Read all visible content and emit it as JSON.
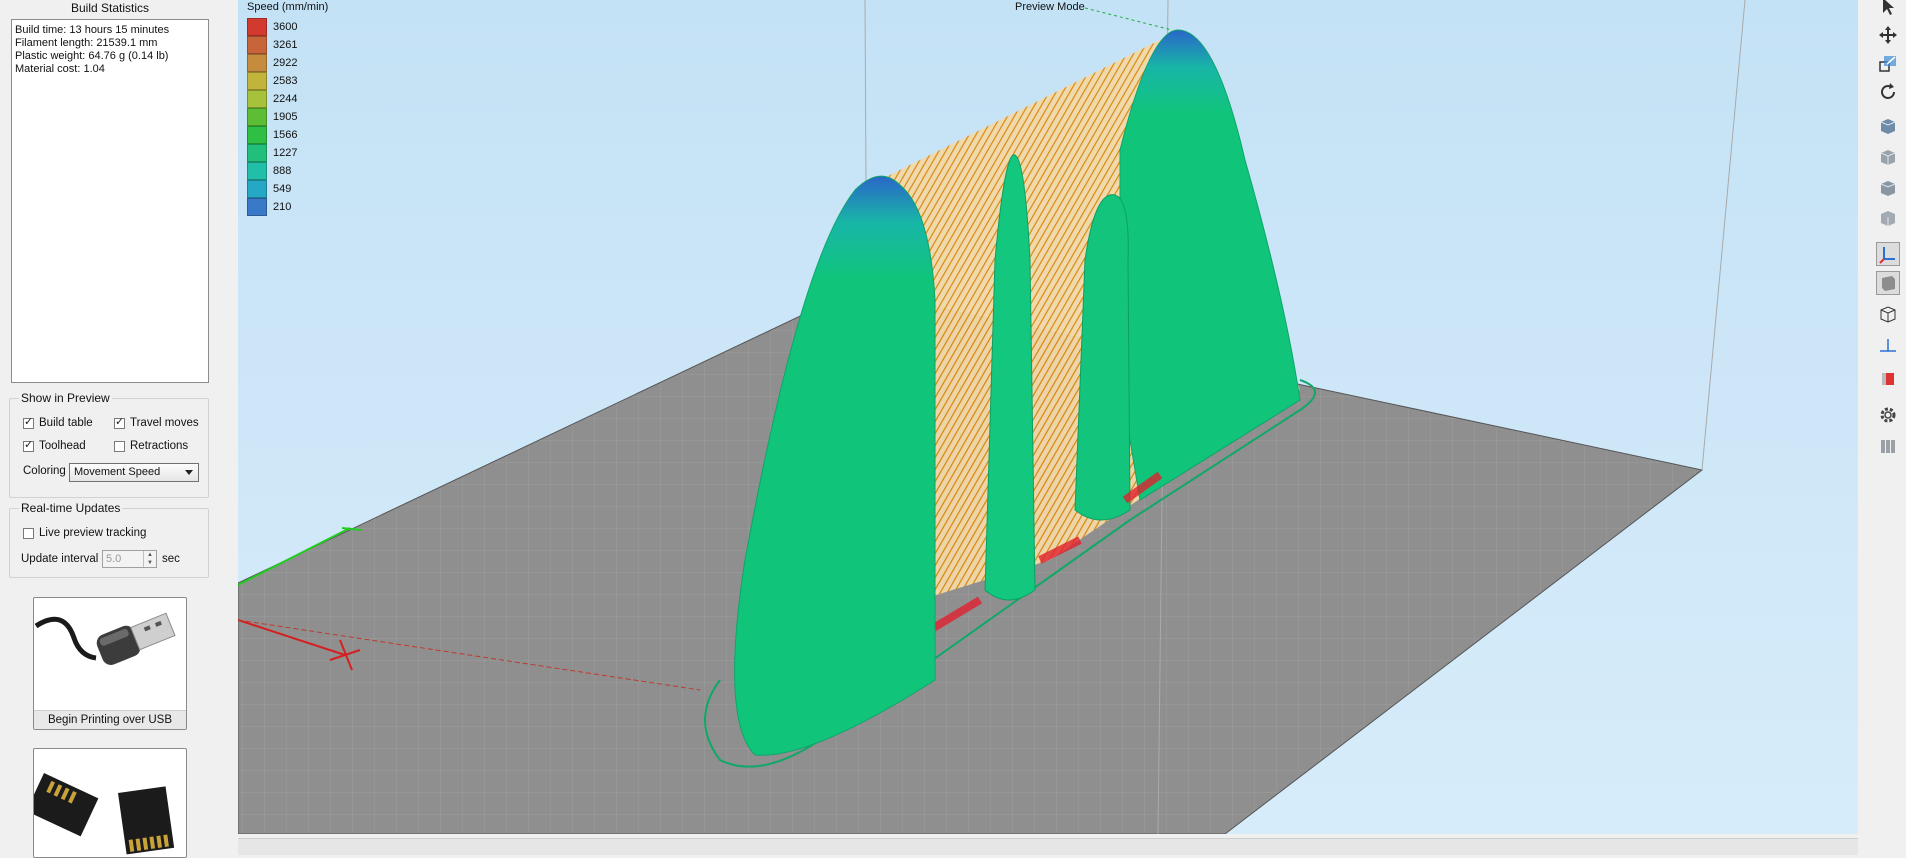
{
  "build_statistics": {
    "title": "Build Statistics",
    "lines": [
      "Build time: 13 hours 15 minutes",
      "Filament length: 21539.1 mm",
      "Plastic weight: 64.76 g (0.14 lb)",
      "Material cost: 1.04"
    ]
  },
  "show_in_preview": {
    "title": "Show in Preview",
    "build_table": {
      "label": "Build table",
      "checked": true
    },
    "travel_moves": {
      "label": "Travel moves",
      "checked": true
    },
    "toolhead": {
      "label": "Toolhead",
      "checked": true
    },
    "retractions": {
      "label": "Retractions",
      "checked": false
    },
    "coloring_label": "Coloring",
    "coloring_value": "Movement Speed"
  },
  "realtime_updates": {
    "title": "Real-time Updates",
    "live_preview": {
      "label": "Live preview tracking",
      "checked": false
    },
    "interval_label": "Update interval",
    "interval_value": "5.0",
    "interval_unit": "sec"
  },
  "buttons": {
    "usb_label": "Begin Printing over USB"
  },
  "viewport": {
    "mode_label": "Preview Mode"
  },
  "legend": {
    "title": "Speed (mm/min)",
    "entries": [
      {
        "value": "3600",
        "color": "#d23a2f"
      },
      {
        "value": "3261",
        "color": "#c8643a"
      },
      {
        "value": "2922",
        "color": "#c48c3c"
      },
      {
        "value": "2583",
        "color": "#c2b33a"
      },
      {
        "value": "2244",
        "color": "#a6c23a"
      },
      {
        "value": "1905",
        "color": "#5dbd34"
      },
      {
        "value": "1566",
        "color": "#2fbf45"
      },
      {
        "value": "1227",
        "color": "#22bf7a"
      },
      {
        "value": "888",
        "color": "#22bfa8"
      },
      {
        "value": "549",
        "color": "#25a8c6"
      },
      {
        "value": "210",
        "color": "#3a78c8"
      }
    ]
  },
  "toolbar_icons": [
    "select-icon",
    "move-icon",
    "scale-icon",
    "rotate-icon",
    "view-iso-icon",
    "view-front-icon",
    "view-top-icon",
    "view-side-icon",
    "axes-icon",
    "solid-view-icon",
    "wireframe-icon",
    "normals-icon",
    "cross-section-icon",
    "settings-gear-icon",
    "columns-icon"
  ],
  "colors": {
    "bed": "#8f8f8f",
    "model": "#10c57a",
    "infill": "#e38d12",
    "sky": "#c8e4f7"
  }
}
